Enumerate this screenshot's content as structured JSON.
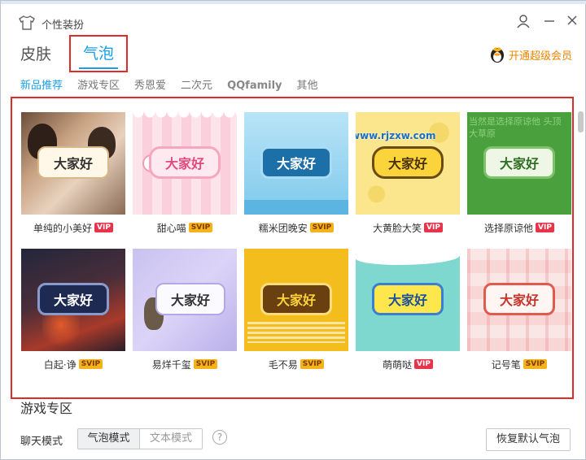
{
  "window": {
    "title": "个性装扮"
  },
  "tabs": {
    "skin": "皮肤",
    "bubble": "气泡"
  },
  "vip_link": "开通超级会员",
  "subtabs": [
    "新品推荐",
    "游戏专区",
    "秀恩爱",
    "二次元",
    "QQfamily",
    "其他"
  ],
  "items": [
    {
      "name": "单纯的小美好",
      "badge": "VIP",
      "bubble_text": "大家好"
    },
    {
      "name": "甜心喵",
      "badge": "SVIP",
      "bubble_text": "大家好"
    },
    {
      "name": "糯米团晚安",
      "badge": "SVIP",
      "bubble_text": "大家好"
    },
    {
      "name": "大黄脸大笑",
      "badge": "VIP",
      "bubble_text": "大家好"
    },
    {
      "name": "选择原谅他",
      "badge": "VIP",
      "bubble_text": "大家好"
    },
    {
      "name": "白起·诤",
      "badge": "SVIP",
      "bubble_text": "大家好"
    },
    {
      "name": "易烊千玺",
      "badge": "SVIP",
      "bubble_text": "大家好"
    },
    {
      "name": "毛不易",
      "badge": "SVIP",
      "bubble_text": "大家好"
    },
    {
      "name": "萌萌哒",
      "badge": "VIP",
      "bubble_text": "大家好"
    },
    {
      "name": "记号笔",
      "badge": "SVIP",
      "bubble_text": "大家好"
    }
  ],
  "watermark": "www.rjzxw.com",
  "pattern_text": "当然是选择原谅他 头顶大草原",
  "section_title": "游戏专区",
  "bottom": {
    "mode_label": "聊天模式",
    "bubble_mode": "气泡模式",
    "text_mode": "文本模式",
    "help": "?",
    "restore": "恢复默认气泡"
  }
}
